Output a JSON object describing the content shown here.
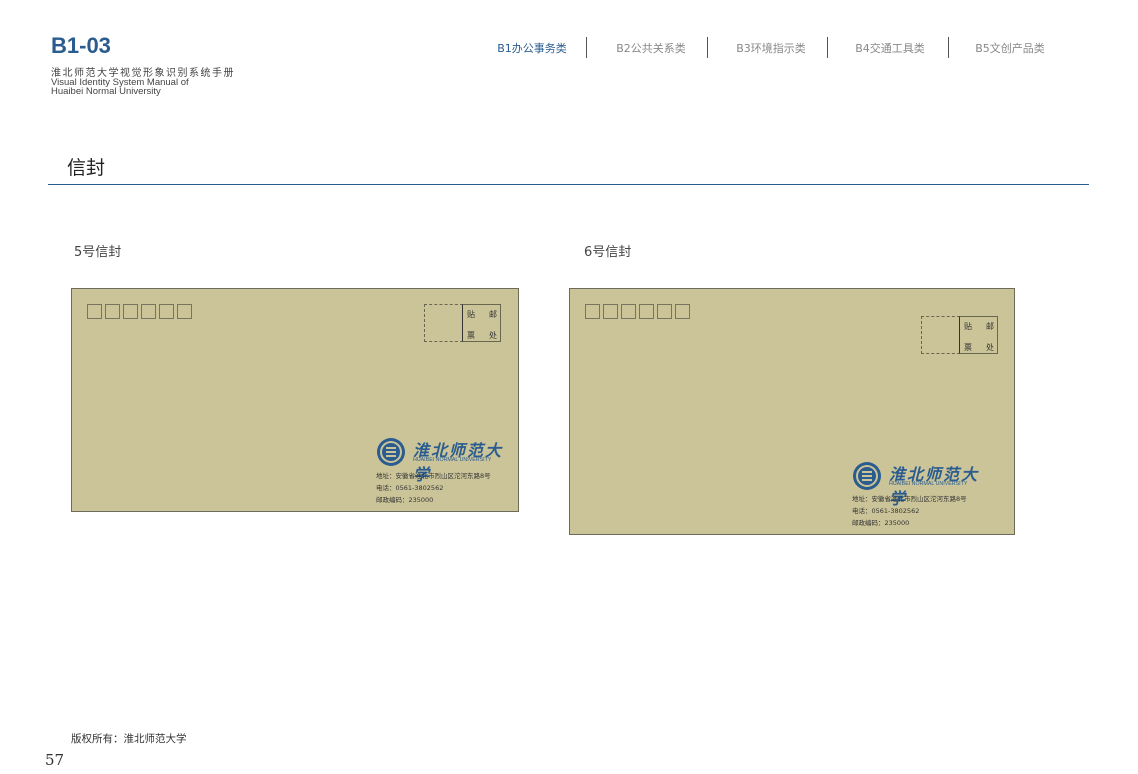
{
  "header": {
    "code": "B1-03",
    "manual_cn": "淮北师范大学视觉形象识别系统手册",
    "manual_en_line1": "Visual Identity System Manual of",
    "manual_en_line2": "Huaibei Normal University"
  },
  "nav": {
    "items": [
      {
        "label": "B1办公事务类",
        "active": true
      },
      {
        "label": "B2公共关系类",
        "active": false
      },
      {
        "label": "B3环境指示类",
        "active": false
      },
      {
        "label": "B4交通工具类",
        "active": false
      },
      {
        "label": "B5文创产品类",
        "active": false
      }
    ]
  },
  "section": {
    "title": "信封"
  },
  "envelopes": [
    {
      "label": "5号信封",
      "stamp_chars": [
        "贴",
        "邮",
        "票",
        "处"
      ],
      "wordmark": "淮北师范大学",
      "wordmark_en": "HUAIBEI NORMAL UNIVERSITY",
      "address": "地址：安徽省淮北市烈山区沱河东路8号",
      "phone": "电话：0561-3802562",
      "postcode": "邮政编码：235000"
    },
    {
      "label": "6号信封",
      "stamp_chars": [
        "贴",
        "邮",
        "票",
        "处"
      ],
      "wordmark": "淮北师范大学",
      "wordmark_en": "HUAIBEI NORMAL UNIVERSITY",
      "address": "地址：安徽省淮北市烈山区沱河东路8号",
      "phone": "电话：0561-3802562",
      "postcode": "邮政编码：235000"
    }
  ],
  "footer": {
    "copyright": "版权所有：淮北师范大学",
    "page_number": "57"
  },
  "colors": {
    "brand_blue": "#2a5c8f",
    "envelope_kraft": "#cbc498"
  }
}
